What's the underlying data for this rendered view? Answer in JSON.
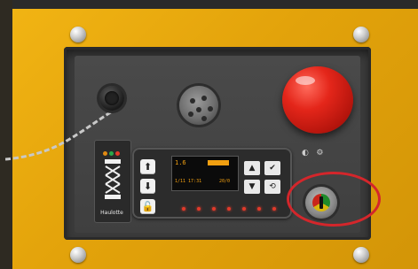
{
  "image": {
    "description": "Close-up of a yellow machine control panel with connectors, a red emergency stop button, a small LCD controller, and a key switch highlighted by a red ellipse."
  },
  "controller": {
    "screen_line_1": "1.6",
    "screen_line_2": "1/11 17:31",
    "screen_line_3": "20/0"
  },
  "brand": {
    "text": "Haulotte"
  },
  "colors": {
    "panel_yellow": "#e8a90c",
    "estop_red": "#e4261a",
    "highlight_red": "#d4262b",
    "display_amber": "#f2a011"
  }
}
